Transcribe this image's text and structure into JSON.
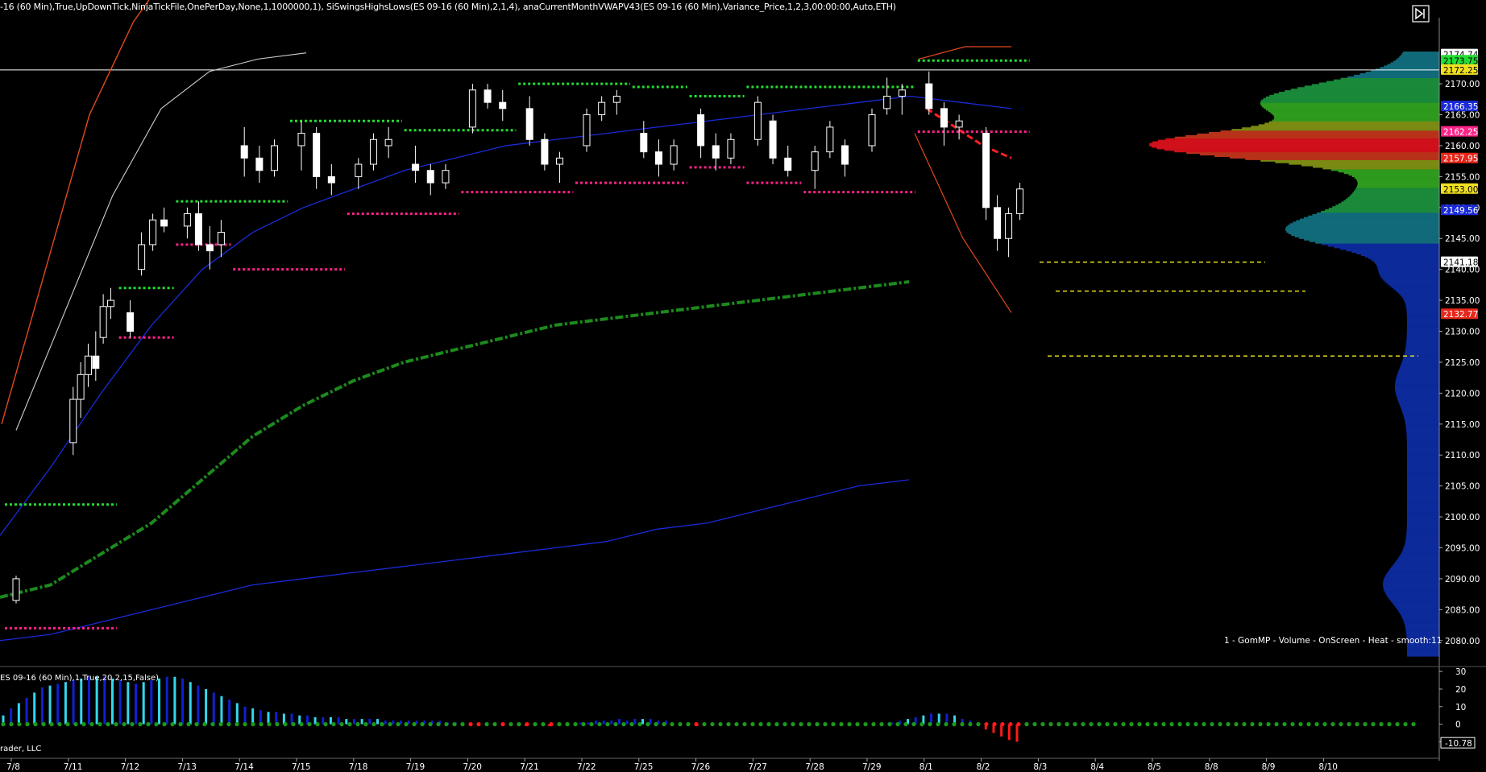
{
  "header_text": "-16 (60 Min),True,UpDownTick,NinjaTickFile,OnePerDay,None,1,1000000,1), SiSwingsHighsLows(ES 09-16 (60 Min),2,1,4), anaCurrentMonthVWAPV43(ES 09-16 (60 Min),Variance_Price,1,2,3,00:00:00,Auto,ETH)",
  "profile_label": "1 - GomMP - Volume - OnScreen - Heat - smooth:11",
  "lower_panel_label": "ES 09-16 (60 Min),1,True,20,2,15,False)",
  "copyright": "rader, LLC",
  "colors": {
    "background": "#000000",
    "candle": "#ffffff",
    "upper_band": "#e0491e",
    "inner_band": "#d0d0d0",
    "vwap_blue": "#1a2ad8",
    "vwap_green": "#1c8a1c",
    "swing_high": "#22dd33",
    "swing_low": "#ff2288",
    "target_line": "#e8e020",
    "hist_cyan": "#33d6ee",
    "hist_blue": "#1020d0",
    "hist_red": "#ff1a1a",
    "dot_green": "#1a9a1a"
  },
  "icons": [
    "play-forward-icon"
  ],
  "chart_data": {
    "type": "candlestick",
    "price_axis": {
      "ylim": [
        2077.5,
        2176.0
      ],
      "ticks": [
        2080,
        2085,
        2090,
        2095,
        2100,
        2105,
        2110,
        2115,
        2120,
        2125,
        2130,
        2135,
        2140,
        2145,
        2150,
        2155,
        2160,
        2165,
        2170
      ],
      "tick_labels": [
        "2080.00",
        "2085.00",
        "2090.00",
        "2095.00",
        "2100.00",
        "2105.00",
        "2110.00",
        "2115.00",
        "2120.00",
        "2125.00",
        "2130.00",
        "2135.00",
        "2140.00",
        "2145.00",
        "2150.00",
        "2155.00",
        "2160.00",
        "2165.00",
        "2170.00"
      ]
    },
    "price_markers": [
      {
        "value": 2174.74,
        "label": "2174.74",
        "bg": "#ffffff",
        "fg": "#000000"
      },
      {
        "value": 2173.75,
        "label": "2173.75",
        "bg": "#22dd33",
        "fg": "#000000"
      },
      {
        "value": 2172.25,
        "label": "2172.25",
        "bg": "#f0e020",
        "fg": "#000000"
      },
      {
        "value": 2166.35,
        "label": "2166.35",
        "bg": "#1a2ad8",
        "fg": "#ffffff"
      },
      {
        "value": 2162.25,
        "label": "2162.25",
        "bg": "#ff2288",
        "fg": "#ffffff"
      },
      {
        "value": 2157.95,
        "label": "2157.95",
        "bg": "#e8261a",
        "fg": "#ffffff"
      },
      {
        "value": 2153.0,
        "label": "2153.00",
        "bg": "#f0e020",
        "fg": "#000000"
      },
      {
        "value": 2149.56,
        "label": "2149.56",
        "bg": "#1a2ad8",
        "fg": "#ffffff"
      },
      {
        "value": 2141.18,
        "label": "2141.18",
        "bg": "#ffffff",
        "fg": "#000000"
      },
      {
        "value": 2132.77,
        "label": "2132.77",
        "bg": "#e8261a",
        "fg": "#ffffff"
      }
    ],
    "horizontal_line": 2172.25,
    "x_axis": {
      "labels": [
        "7/8",
        "7/11",
        "7/12",
        "7/13",
        "7/14",
        "7/15",
        "7/18",
        "7/19",
        "7/20",
        "7/21",
        "7/22",
        "7/25",
        "7/26",
        "7/27",
        "7/28",
        "7/29",
        "8/1",
        "8/2",
        "8/3",
        "8/4",
        "8/5",
        "8/8",
        "8/9",
        "8/10"
      ]
    },
    "candles": [
      {
        "day": "7/8",
        "o": 2086.5,
        "h": 2090.5,
        "l": 2086,
        "c": 2090
      },
      {
        "day": "7/11",
        "o": 2112,
        "h": 2121,
        "l": 2110,
        "c": 2119
      },
      {
        "day": "7/11",
        "o": 2119,
        "h": 2125,
        "l": 2116,
        "c": 2123
      },
      {
        "day": "7/11",
        "o": 2123,
        "h": 2128,
        "l": 2121,
        "c": 2126
      },
      {
        "day": "7/11",
        "o": 2126,
        "h": 2130,
        "l": 2122,
        "c": 2124
      },
      {
        "day": "7/11",
        "o": 2129,
        "h": 2136,
        "l": 2128,
        "c": 2134
      },
      {
        "day": "7/11",
        "o": 2134,
        "h": 2137,
        "l": 2132,
        "c": 2135
      },
      {
        "day": "7/12",
        "o": 2133,
        "h": 2135,
        "l": 2129,
        "c": 2130
      },
      {
        "day": "7/12",
        "o": 2140,
        "h": 2146,
        "l": 2139,
        "c": 2144
      },
      {
        "day": "7/12",
        "o": 2144,
        "h": 2149,
        "l": 2143,
        "c": 2148
      },
      {
        "day": "7/12",
        "o": 2148,
        "h": 2150,
        "l": 2146,
        "c": 2147
      },
      {
        "day": "7/13",
        "o": 2147,
        "h": 2150,
        "l": 2145,
        "c": 2149
      },
      {
        "day": "7/13",
        "o": 2149,
        "h": 2151,
        "l": 2143,
        "c": 2144
      },
      {
        "day": "7/13",
        "o": 2144,
        "h": 2147,
        "l": 2140,
        "c": 2143
      },
      {
        "day": "7/13",
        "o": 2144,
        "h": 2148,
        "l": 2142,
        "c": 2146
      },
      {
        "day": "7/14",
        "o": 2160,
        "h": 2163,
        "l": 2155,
        "c": 2158
      },
      {
        "day": "7/14",
        "o": 2158,
        "h": 2160,
        "l": 2154,
        "c": 2156
      },
      {
        "day": "7/14",
        "o": 2156,
        "h": 2161,
        "l": 2155,
        "c": 2160
      },
      {
        "day": "7/15",
        "o": 2160,
        "h": 2164,
        "l": 2156,
        "c": 2162
      },
      {
        "day": "7/15",
        "o": 2162,
        "h": 2163,
        "l": 2153,
        "c": 2155
      },
      {
        "day": "7/15",
        "o": 2155,
        "h": 2157,
        "l": 2152,
        "c": 2154
      },
      {
        "day": "7/18",
        "o": 2155,
        "h": 2158,
        "l": 2153,
        "c": 2157
      },
      {
        "day": "7/18",
        "o": 2157,
        "h": 2162,
        "l": 2156,
        "c": 2161
      },
      {
        "day": "7/18",
        "o": 2160,
        "h": 2163,
        "l": 2158,
        "c": 2161
      },
      {
        "day": "7/19",
        "o": 2157,
        "h": 2160,
        "l": 2154,
        "c": 2156
      },
      {
        "day": "7/19",
        "o": 2156,
        "h": 2157,
        "l": 2152,
        "c": 2154
      },
      {
        "day": "7/19",
        "o": 2154,
        "h": 2157,
        "l": 2153,
        "c": 2156
      },
      {
        "day": "7/20",
        "o": 2163,
        "h": 2170,
        "l": 2162,
        "c": 2169
      },
      {
        "day": "7/20",
        "o": 2169,
        "h": 2170,
        "l": 2166,
        "c": 2167
      },
      {
        "day": "7/20",
        "o": 2167,
        "h": 2169,
        "l": 2164,
        "c": 2166
      },
      {
        "day": "7/21",
        "o": 2166,
        "h": 2168,
        "l": 2160,
        "c": 2161
      },
      {
        "day": "7/21",
        "o": 2161,
        "h": 2162,
        "l": 2156,
        "c": 2157
      },
      {
        "day": "7/21",
        "o": 2157,
        "h": 2159,
        "l": 2154,
        "c": 2158
      },
      {
        "day": "7/22",
        "o": 2160,
        "h": 2166,
        "l": 2159,
        "c": 2165
      },
      {
        "day": "7/22",
        "o": 2165,
        "h": 2168,
        "l": 2164,
        "c": 2167
      },
      {
        "day": "7/22",
        "o": 2167,
        "h": 2169,
        "l": 2165,
        "c": 2168
      },
      {
        "day": "7/25",
        "o": 2162,
        "h": 2164,
        "l": 2158,
        "c": 2159
      },
      {
        "day": "7/25",
        "o": 2159,
        "h": 2161,
        "l": 2155,
        "c": 2157
      },
      {
        "day": "7/25",
        "o": 2157,
        "h": 2161,
        "l": 2156,
        "c": 2160
      },
      {
        "day": "7/26",
        "o": 2165,
        "h": 2166,
        "l": 2158,
        "c": 2160
      },
      {
        "day": "7/26",
        "o": 2160,
        "h": 2162,
        "l": 2156,
        "c": 2158
      },
      {
        "day": "7/26",
        "o": 2158,
        "h": 2162,
        "l": 2157,
        "c": 2161
      },
      {
        "day": "7/27",
        "o": 2161,
        "h": 2168,
        "l": 2160,
        "c": 2167
      },
      {
        "day": "7/27",
        "o": 2164,
        "h": 2165,
        "l": 2157,
        "c": 2158
      },
      {
        "day": "7/27",
        "o": 2158,
        "h": 2160,
        "l": 2155,
        "c": 2156
      },
      {
        "day": "7/28",
        "o": 2156,
        "h": 2160,
        "l": 2153,
        "c": 2159
      },
      {
        "day": "7/28",
        "o": 2159,
        "h": 2164,
        "l": 2158,
        "c": 2163
      },
      {
        "day": "7/28",
        "o": 2160,
        "h": 2161,
        "l": 2155,
        "c": 2157
      },
      {
        "day": "7/29",
        "o": 2160,
        "h": 2166,
        "l": 2159,
        "c": 2165
      },
      {
        "day": "7/29",
        "o": 2166,
        "h": 2171,
        "l": 2165,
        "c": 2168
      },
      {
        "day": "7/29",
        "o": 2168,
        "h": 2170,
        "l": 2165,
        "c": 2169
      },
      {
        "day": "8/1",
        "o": 2170,
        "h": 2172,
        "l": 2165,
        "c": 2166
      },
      {
        "day": "8/1",
        "o": 2166,
        "h": 2167,
        "l": 2160,
        "c": 2163
      },
      {
        "day": "8/1",
        "o": 2163,
        "h": 2165,
        "l": 2161,
        "c": 2164
      },
      {
        "day": "8/2",
        "o": 2162,
        "h": 2163,
        "l": 2148,
        "c": 2150
      },
      {
        "day": "8/2",
        "o": 2150,
        "h": 2152,
        "l": 2143,
        "c": 2145
      },
      {
        "day": "8/2",
        "o": 2145,
        "h": 2150,
        "l": 2142,
        "c": 2149
      },
      {
        "day": "8/2",
        "o": 2149,
        "h": 2154,
        "l": 2148,
        "c": 2153
      }
    ],
    "swing_highs": [
      {
        "y": 2102,
        "x0": "7/8",
        "x1": "7/11"
      },
      {
        "y": 2137,
        "x0": "7/12",
        "x1": "7/12"
      },
      {
        "y": 2151,
        "x0": "7/13",
        "x1": "7/14"
      },
      {
        "y": 2164,
        "x0": "7/15",
        "x1": "7/18"
      },
      {
        "y": 2162.5,
        "x0": "7/19",
        "x1": "7/20"
      },
      {
        "y": 2170,
        "x0": "7/21",
        "x1": "7/22"
      },
      {
        "y": 2169.5,
        "x0": "7/25",
        "x1": "7/25"
      },
      {
        "y": 2168,
        "x0": "7/26",
        "x1": "7/26"
      },
      {
        "y": 2169.5,
        "x0": "7/27",
        "x1": "7/29"
      },
      {
        "y": 2173.75,
        "x0": "8/1",
        "x1": "8/2"
      }
    ],
    "swing_lows": [
      {
        "y": 2082,
        "x0": "7/8",
        "x1": "7/11"
      },
      {
        "y": 2129,
        "x0": "7/12",
        "x1": "7/12"
      },
      {
        "y": 2144,
        "x0": "7/13",
        "x1": "7/13"
      },
      {
        "y": 2140,
        "x0": "7/14",
        "x1": "7/15"
      },
      {
        "y": 2149,
        "x0": "7/18",
        "x1": "7/19"
      },
      {
        "y": 2152.5,
        "x0": "7/20",
        "x1": "7/21"
      },
      {
        "y": 2154,
        "x0": "7/22",
        "x1": "7/25"
      },
      {
        "y": 2156.5,
        "x0": "7/26",
        "x1": "7/26"
      },
      {
        "y": 2154,
        "x0": "7/27",
        "x1": "7/27"
      },
      {
        "y": 2152.5,
        "x0": "7/28",
        "x1": "7/29"
      },
      {
        "y": 2162.25,
        "x0": "8/1",
        "x1": "8/2"
      }
    ],
    "vwap_green": [
      2087,
      2089,
      2094,
      2099,
      2106,
      2113,
      2118,
      2122,
      2125,
      2127,
      2129,
      2131,
      2132,
      2133,
      2134,
      2135,
      2136,
      2137,
      2138
    ],
    "vwap_lower_blue": [
      2080,
      2081,
      2083,
      2085,
      2087,
      2089,
      2090,
      2091,
      2092,
      2093,
      2094,
      2095,
      2096,
      2098,
      2099,
      2101,
      2103,
      2105,
      2106
    ],
    "vwap_upper_blue": [
      2097,
      2108,
      2120,
      2131,
      2140,
      2146,
      2150,
      2153,
      2156,
      2158,
      2160,
      2161,
      2162,
      2163,
      2164,
      2165,
      2166,
      2167,
      2168,
      2167,
      2166
    ],
    "upper_band_orange": [
      2115,
      2140,
      2165,
      2180,
      2190
    ],
    "inner_band_white": [
      2114,
      2133,
      2152,
      2166,
      2172,
      2174,
      2175
    ],
    "last_session_bands": {
      "upper": [
        2174,
        2176,
        2176
      ],
      "lower": [
        2162,
        2145,
        2133
      ]
    },
    "projected_vwap": [
      2166,
      2163,
      2160,
      2158
    ],
    "target_lines": [
      {
        "y": 2141.18
      },
      {
        "y": 2136.5
      },
      {
        "y": 2126.0
      }
    ],
    "volume_profile_poc": 2160.0,
    "lower_indicator": {
      "ylim": [
        -13,
        31
      ],
      "ticks": [
        -10,
        0,
        10,
        20,
        30
      ],
      "tick_labels": [
        "0",
        "10",
        "20",
        "30"
      ],
      "current_label": "-10.78",
      "values": [
        5,
        9,
        12,
        15,
        18,
        21,
        22,
        23,
        24,
        25,
        26,
        27,
        27,
        27,
        26,
        25,
        24,
        23,
        24,
        25,
        26,
        27,
        27,
        26,
        24,
        22,
        20,
        18,
        16,
        14,
        12,
        10,
        9,
        8,
        7,
        7,
        6,
        6,
        5,
        5,
        4,
        4,
        4,
        4,
        3,
        3,
        3,
        3,
        3,
        2,
        2,
        2,
        2,
        2,
        2,
        2,
        2,
        1,
        1,
        0,
        -1,
        -1,
        0,
        0,
        -1,
        0,
        0,
        -1,
        0,
        0,
        -1,
        0,
        0,
        0,
        1,
        1,
        2,
        2,
        2,
        3,
        2,
        3,
        3,
        3,
        2,
        2,
        0,
        0,
        0,
        -1,
        0,
        0,
        0,
        0,
        0,
        0,
        0,
        0,
        0,
        0,
        0,
        0,
        0,
        0,
        0,
        0,
        0,
        0,
        0,
        0,
        0,
        0,
        0,
        0,
        1,
        2,
        3,
        4,
        5,
        6,
        6,
        6,
        5,
        3,
        2,
        0,
        -3,
        -5,
        -7,
        -9,
        -10
      ]
    }
  }
}
